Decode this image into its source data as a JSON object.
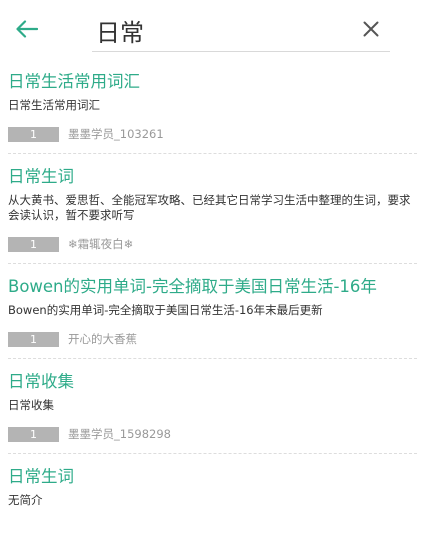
{
  "colors": {
    "accent": "#2eab89",
    "badge_bg": "#b4b4b4",
    "muted_text": "#999999"
  },
  "icons": {
    "back": "arrow-left-icon",
    "clear": "close-icon"
  },
  "search": {
    "query": "日常"
  },
  "results": [
    {
      "title": "日常生活常用词汇",
      "description": "日常生活常用词汇",
      "count": "1",
      "author": "墨墨学员_103261"
    },
    {
      "title": "日常生词",
      "description": "从大黄书、爱思哲、全能冠军攻略、已经其它日常学习生活中整理的生词，要求会读认识，暂不要求听写",
      "count": "1",
      "author": "❄霜辄夜白❄"
    },
    {
      "title": "Bowen的实用单词-完全摘取于美国日常生活-16年",
      "description": "Bowen的实用单词-完全摘取于美国日常生活-16年末最后更新",
      "count": "1",
      "author": "开心的大香蕉"
    },
    {
      "title": "日常收集",
      "description": "日常收集",
      "count": "1",
      "author": "墨墨学员_1598298"
    },
    {
      "title": "日常生词",
      "description": "无简介"
    }
  ]
}
